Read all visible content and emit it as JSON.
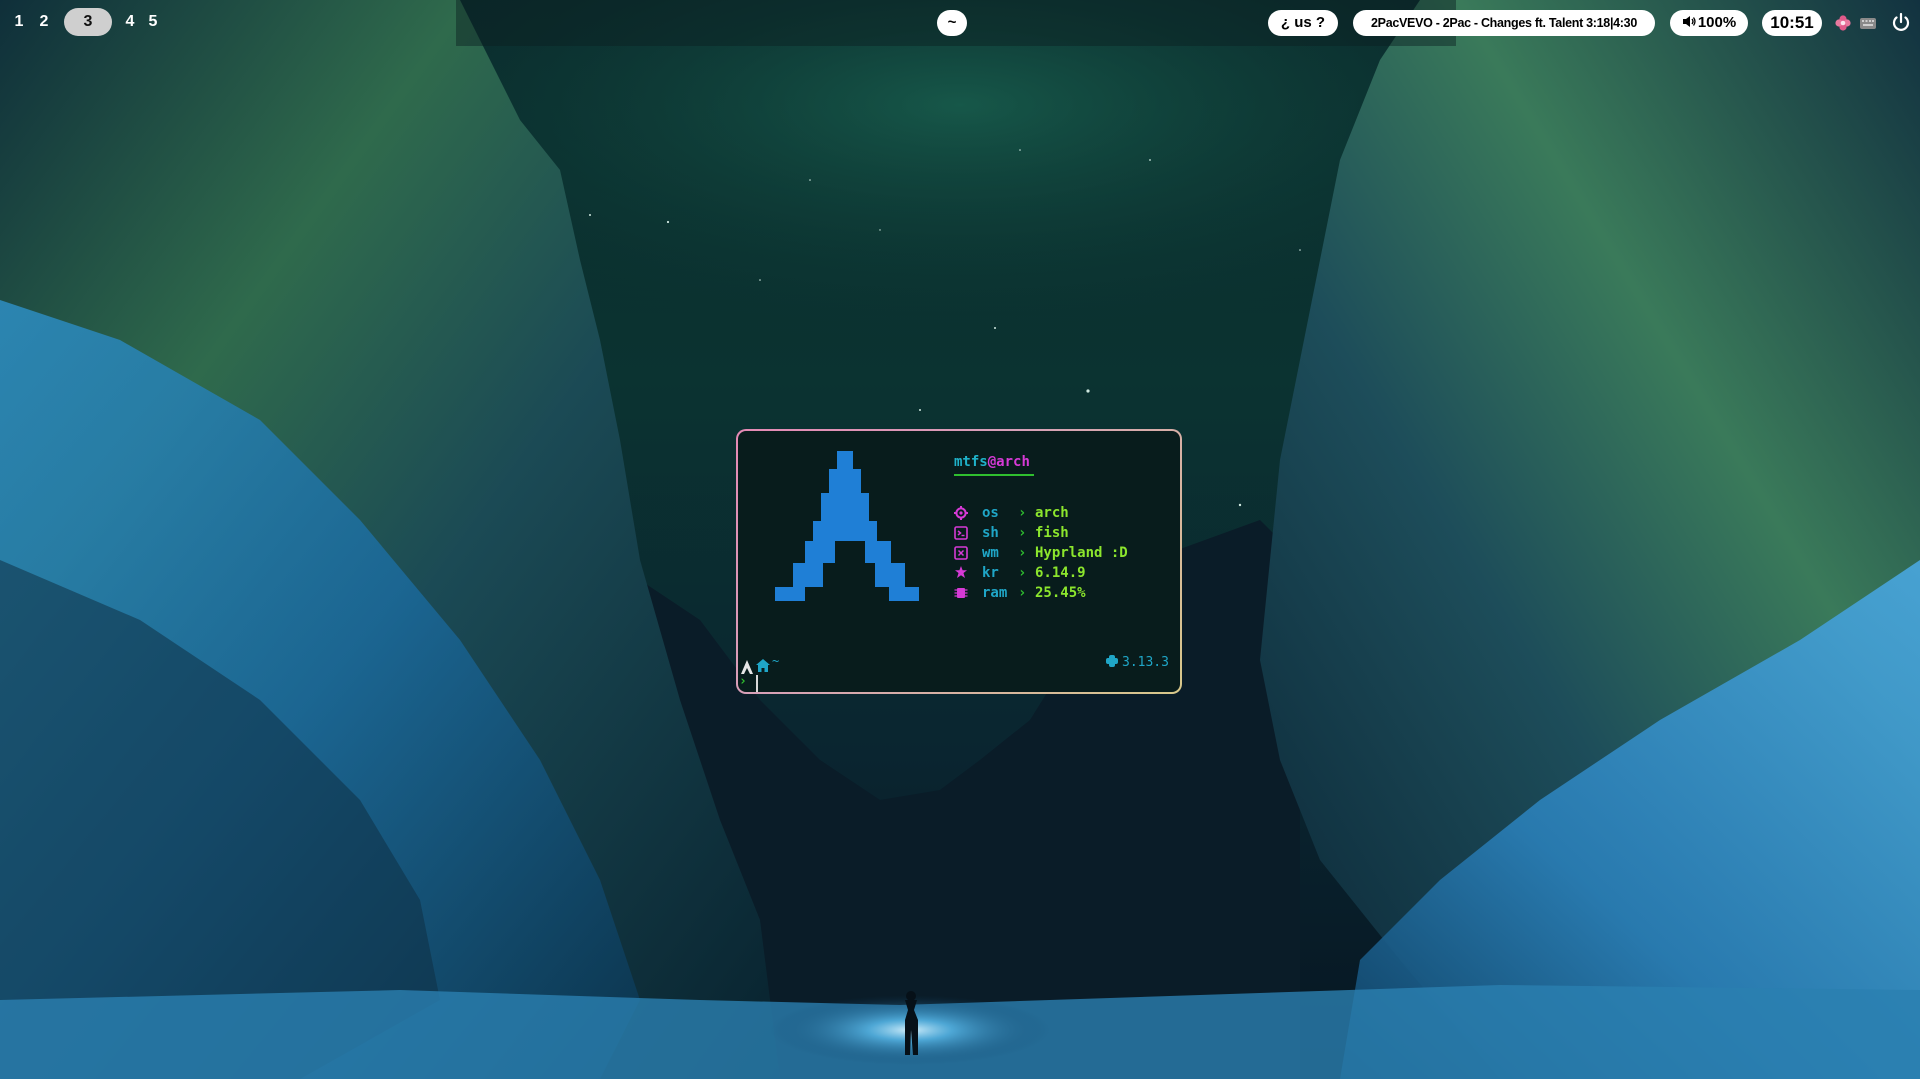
{
  "workspaces": [
    {
      "label": "1",
      "active": false
    },
    {
      "label": "2",
      "active": false
    },
    {
      "label": "3",
      "active": true
    },
    {
      "label": "4",
      "active": false
    },
    {
      "label": "5",
      "active": false
    }
  ],
  "bar": {
    "shell_label": "~",
    "language_label": "¿ us ?",
    "media_label": "2PacVEVO - 2Pac - Changes ft. Talent 3:18|4:30",
    "volume_label": "100%",
    "clock": "10:51",
    "tray_icons": [
      "flower-icon",
      "keyboard-icon",
      "power-icon"
    ]
  },
  "terminal": {
    "user": "mtfs",
    "at": "@",
    "host": "arch",
    "fetch": [
      {
        "icon": "gear-icon",
        "key": "os",
        "value": "arch"
      },
      {
        "icon": "terminal-icon",
        "key": "sh",
        "value": "fish"
      },
      {
        "icon": "window-icon",
        "key": "wm",
        "value": "Hyprland :D"
      },
      {
        "icon": "gear-star-icon",
        "key": "kr",
        "value": "6.14.9"
      },
      {
        "icon": "chip-icon",
        "key": "ram",
        "value": "25.45%"
      }
    ],
    "arrow": "›",
    "prompt_dir": "~",
    "prompt_caret": "›",
    "python_version": "3.13.3"
  },
  "colors": {
    "cyan": "#1fa6c7",
    "magenta": "#d63ad6",
    "green": "#8ce62d",
    "arch_blue": "#1f7fd6",
    "terminal_bg": "#081c1c"
  }
}
